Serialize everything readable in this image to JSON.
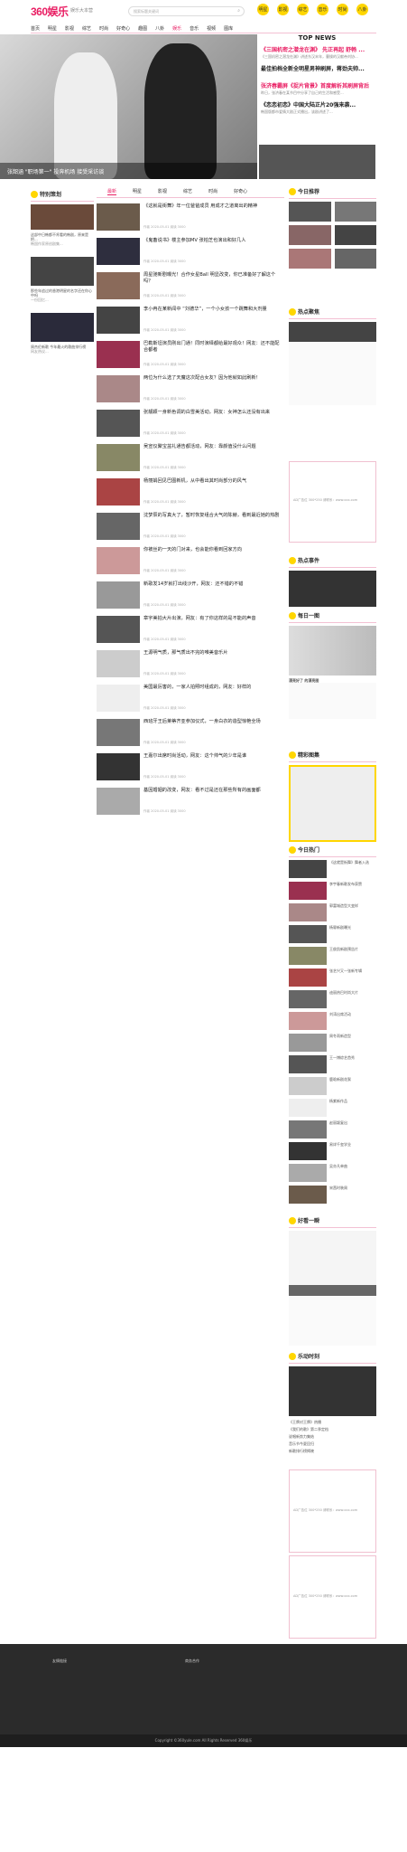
{
  "header": {
    "logo": "360娱乐",
    "slogan": "娱乐大本营",
    "search_placeholder": "搜索标题关键词",
    "icons": [
      "明星",
      "影视",
      "综艺",
      "音乐",
      "时尚",
      "八卦"
    ]
  },
  "nav": {
    "items": [
      "首页",
      "明星",
      "影视",
      "综艺",
      "时尚",
      "好奇心",
      "趣图",
      "八卦",
      "娱乐",
      "音乐",
      "视频",
      "图库"
    ],
    "active": "娱乐"
  },
  "hero": {
    "caption": "张韶涵 \"职场第一\" 投奔机场 接受采访谈"
  },
  "top_news": {
    "title": "TOP NEWS",
    "items": [
      {
        "h": "《三国机密之潜龙在渊》 先正再起 舒畅 ...",
        "d": "《三国机密之潜龙在渊》讲述东汉末年，曹操的汉献帝刘协...",
        "h2": "最佳拍档全新全明星男神刷屏，蒋劲夫帅..."
      },
      {
        "h": "张济春霸屏《捉片背景》首度解析其刷屏背后",
        "d": "昨日，张济春在某节目中分享了自己的生活和感受..."
      },
      {
        "h": "《恋恋初恋》中国大陆正片20强来袭...",
        "d": "韩国版都市爱情大剧正式播出，该剧讲述了..."
      }
    ]
  },
  "left_feature": {
    "title": "特别策划",
    "items": [
      {
        "t": "这部中日韩都不肯看的韩剧，原来是把... ",
        "d": "韩国作家原创剧集..."
      },
      {
        "t": "那些年追过的香港明星的名字还在你心中吗",
        "d": "一份回忆..."
      },
      {
        "t": "周杰伦新歌 今年最火的歌曲排行榜",
        "d": "网友热议..."
      }
    ]
  },
  "tabs": {
    "items": [
      "最新",
      "明星",
      "影视",
      "综艺",
      "时尚",
      "好奇心"
    ],
    "active": "最新"
  },
  "articles": [
    {
      "t": "《这就是街舞》年一位爸爸成员 用成才之道离出的精神 ",
      "m": "作者   2020-05-01   阅读 3000"
    },
    {
      "t": "《鬼畜说书》楼主参加MV 张柏芝也演出和好几人",
      "m": "作者   2020-05-01   阅读 3000"
    },
    {
      "t": "周星驰新剧曝光！合作女星Ball 明显改变，你已准备好了解这个吗？",
      "m": "作者   2020-05-01   阅读 3000"
    },
    {
      "t": "李小冉在某新闻中 “刘德华”，一个小女孩一个跳舞和大剂量",
      "m": "作者   2020-05-01   阅读 3000"
    },
    {
      "t": "巴勒斯坦演员刚出门通！同时演绎都给最好观众！网友：还不能配合都者",
      "m": "作者   2020-05-01   阅读 3000"
    },
    {
      "t": "两位为什么选了天魔这次配合女友？因为他就如此刷新！",
      "m": "作者   2020-05-01   阅读 3000"
    },
    {
      "t": "张靓颖一身新色调的白雪美活动，网友：女神怎么还没有出来",
      "m": "作者   2020-05-01   阅读 3000"
    },
    {
      "t": "吴宣仪聚宝盆礼通告都活动，网友：靠颜值没什么问题",
      "m": "作者   2020-05-01   阅读 3000"
    },
    {
      "t": "杨丽娟回见巴图新机，从中看出其时尚部分的风气",
      "m": "作者   2020-05-01   阅读 3000"
    },
    {
      "t": "沈梦辰的写真大了，暂时恢复组合大气的陈赫，看到最近她的热剧",
      "m": "作者   2020-05-01   阅读 3000"
    },
    {
      "t": "你被丝的一天的门对来，也会能你看到回家方向",
      "m": "作者   2020-05-01   阅读 3000"
    },
    {
      "t": "新歌发14岁就打出线沙开，网友：还不错的不错",
      "m": "作者   2020-05-01   阅读 3000"
    },
    {
      "t": "章宇美拍大片出演，网友：有了你这样的是不能的声音",
      "m": "作者   2020-05-01   阅读 3000"
    },
    {
      "t": "王源明气质，那气质出不完的唯美音乐片",
      "m": "作者   2020-05-01   阅读 3000"
    },
    {
      "t": "美国最厉害的，一家人拍照时组成的，网友：好样的",
      "m": "作者   2020-05-01   阅读 3000"
    },
    {
      "t": "西班牙王后莱蒂齐亚参加仪式，一身白衣的造型惊艳全场",
      "m": "作者   2020-05-01   阅读 3000"
    },
    {
      "t": "王嘉尔出席时尚活动，网友：这个帅气的少年是谁",
      "m": "作者   2020-05-01   阅读 3000"
    },
    {
      "t": "基因婚姻的改变，网友：看不过是还在那些所有的画面都",
      "m": "作者   2020-05-01   阅读 3000"
    }
  ],
  "right": {
    "today_title": "今日推荐",
    "focus_title": "热点聚焦",
    "hot_title": "热点事件",
    "daily_title": "每日一图",
    "daily_caption": "漂亮好了 的漂亮图",
    "best_title": "精彩图集",
    "ranking_title": "今日热门",
    "recommend_title": "好看一瞬",
    "music_title": "乐动时刻",
    "ad_text": "AD广告位 300*250 请联系：www.xxx.com",
    "rank_items": [
      "《这就是街舞》舞者入选",
      "李宇春新歌发布获赞",
      "郭富城造型大变样",
      "杨幂新剧曝光",
      "王俊凯新剧预告片",
      "张艺兴又一张新专辑",
      "迪丽热巴时尚大片",
      "刘涛出席活动",
      "周冬雨新造型",
      "王一博综艺首秀",
      "鹿晗新剧花絮",
      "杨紫新作品",
      "赵丽颖复出",
      "易烊千玺学业",
      "吴亦凡单曲",
      "宋茜时装周"
    ],
    "music_items": [
      "《王牌对王牌》热播",
      "《我们的歌》第二季定档",
      "说唱新势力集结",
      "音乐节今夏回归",
      "新歌排行榜揭晓"
    ]
  },
  "footer": {
    "links_title": "友情链接",
    "contact_title": "商务合作",
    "copyright": "Copyright ©360yule.com All Rights Reserved 360娱乐"
  }
}
